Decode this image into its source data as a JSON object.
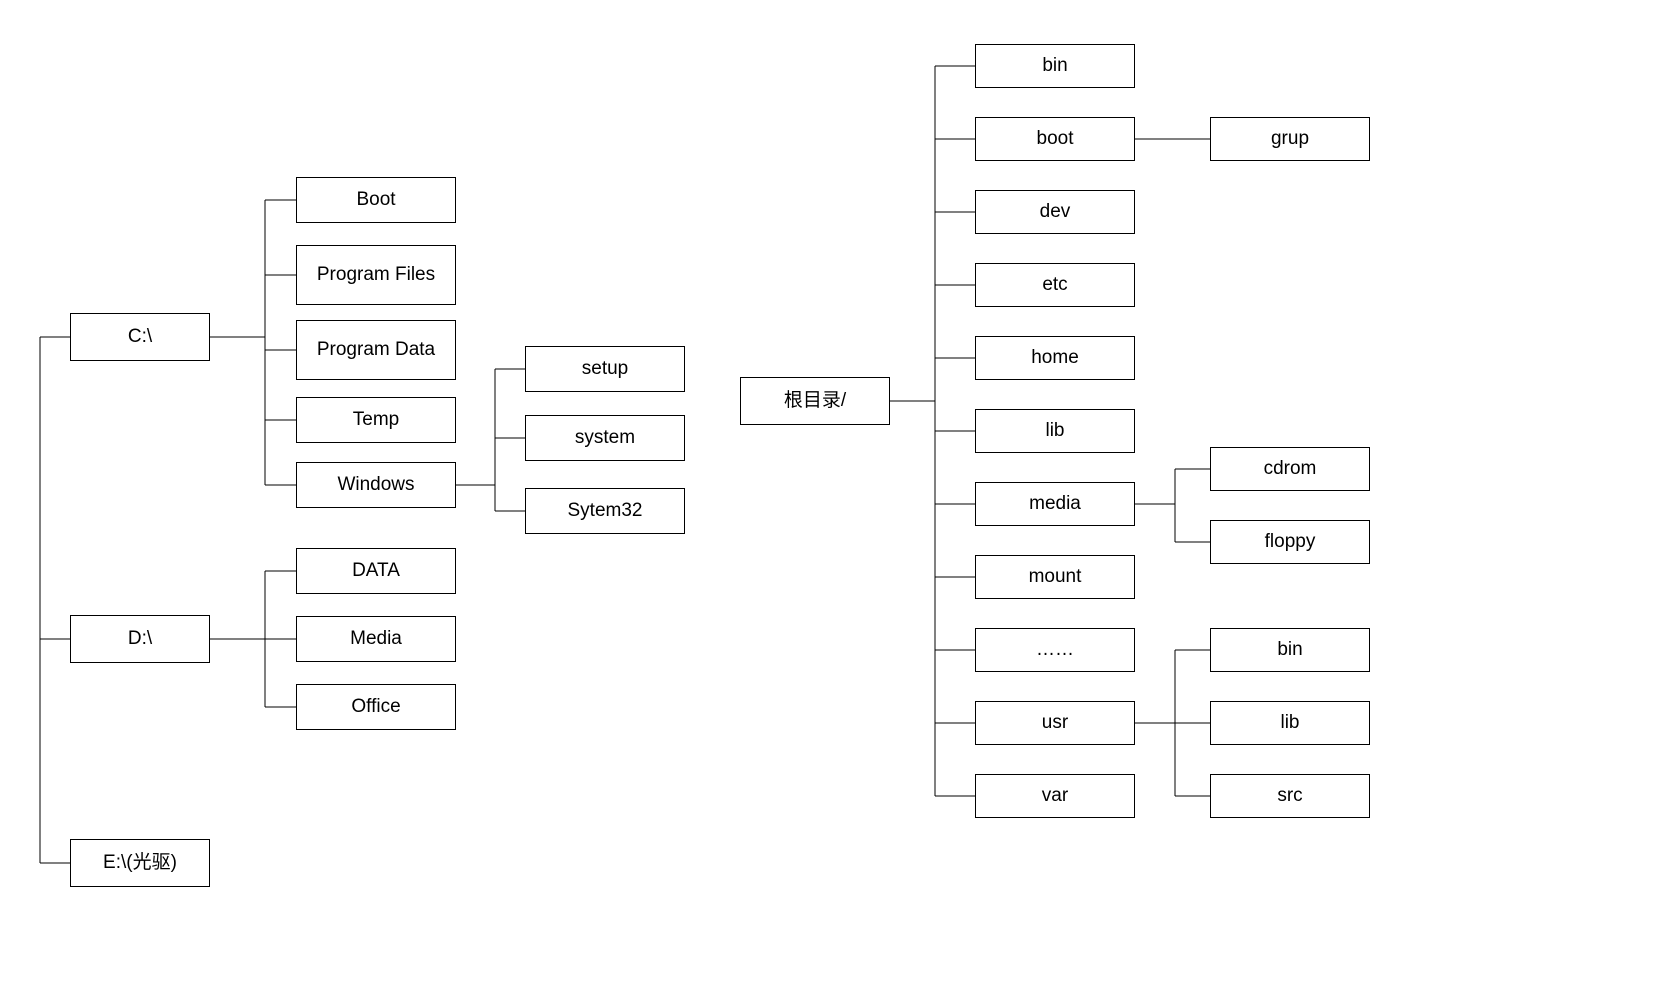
{
  "left": {
    "roots": [
      {
        "label": "C:\\"
      },
      {
        "label": "D:\\"
      },
      {
        "label": "E:\\(光驱)"
      }
    ],
    "c_children": [
      {
        "label": "Boot"
      },
      {
        "label": "Program Files"
      },
      {
        "label": "Program Data"
      },
      {
        "label": "Temp"
      },
      {
        "label": "Windows"
      }
    ],
    "windows_children": [
      {
        "label": "setup"
      },
      {
        "label": "system"
      },
      {
        "label": "Sytem32"
      }
    ],
    "d_children": [
      {
        "label": "DATA"
      },
      {
        "label": "Media"
      },
      {
        "label": "Office"
      }
    ]
  },
  "right": {
    "root": {
      "label": "根目录/"
    },
    "root_children": [
      {
        "label": "bin"
      },
      {
        "label": "boot"
      },
      {
        "label": "dev"
      },
      {
        "label": "etc"
      },
      {
        "label": "home"
      },
      {
        "label": "lib"
      },
      {
        "label": "media"
      },
      {
        "label": "mount"
      },
      {
        "label": "……"
      },
      {
        "label": "usr"
      },
      {
        "label": "var"
      }
    ],
    "boot_children": [
      {
        "label": "grup"
      }
    ],
    "media_children": [
      {
        "label": "cdrom"
      },
      {
        "label": "floppy"
      }
    ],
    "usr_children": [
      {
        "label": "bin"
      },
      {
        "label": "lib"
      },
      {
        "label": "src"
      }
    ]
  }
}
